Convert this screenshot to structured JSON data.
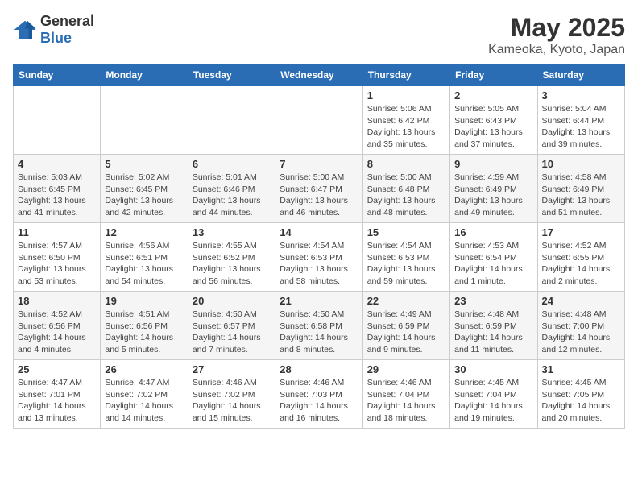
{
  "header": {
    "logo_general": "General",
    "logo_blue": "Blue",
    "title": "May 2025",
    "subtitle": "Kameoka, Kyoto, Japan"
  },
  "calendar": {
    "days_of_week": [
      "Sunday",
      "Monday",
      "Tuesday",
      "Wednesday",
      "Thursday",
      "Friday",
      "Saturday"
    ],
    "weeks": [
      [
        {
          "day": "",
          "info": ""
        },
        {
          "day": "",
          "info": ""
        },
        {
          "day": "",
          "info": ""
        },
        {
          "day": "",
          "info": ""
        },
        {
          "day": "1",
          "info": "Sunrise: 5:06 AM\nSunset: 6:42 PM\nDaylight: 13 hours\nand 35 minutes."
        },
        {
          "day": "2",
          "info": "Sunrise: 5:05 AM\nSunset: 6:43 PM\nDaylight: 13 hours\nand 37 minutes."
        },
        {
          "day": "3",
          "info": "Sunrise: 5:04 AM\nSunset: 6:44 PM\nDaylight: 13 hours\nand 39 minutes."
        }
      ],
      [
        {
          "day": "4",
          "info": "Sunrise: 5:03 AM\nSunset: 6:45 PM\nDaylight: 13 hours\nand 41 minutes."
        },
        {
          "day": "5",
          "info": "Sunrise: 5:02 AM\nSunset: 6:45 PM\nDaylight: 13 hours\nand 42 minutes."
        },
        {
          "day": "6",
          "info": "Sunrise: 5:01 AM\nSunset: 6:46 PM\nDaylight: 13 hours\nand 44 minutes."
        },
        {
          "day": "7",
          "info": "Sunrise: 5:00 AM\nSunset: 6:47 PM\nDaylight: 13 hours\nand 46 minutes."
        },
        {
          "day": "8",
          "info": "Sunrise: 5:00 AM\nSunset: 6:48 PM\nDaylight: 13 hours\nand 48 minutes."
        },
        {
          "day": "9",
          "info": "Sunrise: 4:59 AM\nSunset: 6:49 PM\nDaylight: 13 hours\nand 49 minutes."
        },
        {
          "day": "10",
          "info": "Sunrise: 4:58 AM\nSunset: 6:49 PM\nDaylight: 13 hours\nand 51 minutes."
        }
      ],
      [
        {
          "day": "11",
          "info": "Sunrise: 4:57 AM\nSunset: 6:50 PM\nDaylight: 13 hours\nand 53 minutes."
        },
        {
          "day": "12",
          "info": "Sunrise: 4:56 AM\nSunset: 6:51 PM\nDaylight: 13 hours\nand 54 minutes."
        },
        {
          "day": "13",
          "info": "Sunrise: 4:55 AM\nSunset: 6:52 PM\nDaylight: 13 hours\nand 56 minutes."
        },
        {
          "day": "14",
          "info": "Sunrise: 4:54 AM\nSunset: 6:53 PM\nDaylight: 13 hours\nand 58 minutes."
        },
        {
          "day": "15",
          "info": "Sunrise: 4:54 AM\nSunset: 6:53 PM\nDaylight: 13 hours\nand 59 minutes."
        },
        {
          "day": "16",
          "info": "Sunrise: 4:53 AM\nSunset: 6:54 PM\nDaylight: 14 hours\nand 1 minute."
        },
        {
          "day": "17",
          "info": "Sunrise: 4:52 AM\nSunset: 6:55 PM\nDaylight: 14 hours\nand 2 minutes."
        }
      ],
      [
        {
          "day": "18",
          "info": "Sunrise: 4:52 AM\nSunset: 6:56 PM\nDaylight: 14 hours\nand 4 minutes."
        },
        {
          "day": "19",
          "info": "Sunrise: 4:51 AM\nSunset: 6:56 PM\nDaylight: 14 hours\nand 5 minutes."
        },
        {
          "day": "20",
          "info": "Sunrise: 4:50 AM\nSunset: 6:57 PM\nDaylight: 14 hours\nand 7 minutes."
        },
        {
          "day": "21",
          "info": "Sunrise: 4:50 AM\nSunset: 6:58 PM\nDaylight: 14 hours\nand 8 minutes."
        },
        {
          "day": "22",
          "info": "Sunrise: 4:49 AM\nSunset: 6:59 PM\nDaylight: 14 hours\nand 9 minutes."
        },
        {
          "day": "23",
          "info": "Sunrise: 4:48 AM\nSunset: 6:59 PM\nDaylight: 14 hours\nand 11 minutes."
        },
        {
          "day": "24",
          "info": "Sunrise: 4:48 AM\nSunset: 7:00 PM\nDaylight: 14 hours\nand 12 minutes."
        }
      ],
      [
        {
          "day": "25",
          "info": "Sunrise: 4:47 AM\nSunset: 7:01 PM\nDaylight: 14 hours\nand 13 minutes."
        },
        {
          "day": "26",
          "info": "Sunrise: 4:47 AM\nSunset: 7:02 PM\nDaylight: 14 hours\nand 14 minutes."
        },
        {
          "day": "27",
          "info": "Sunrise: 4:46 AM\nSunset: 7:02 PM\nDaylight: 14 hours\nand 15 minutes."
        },
        {
          "day": "28",
          "info": "Sunrise: 4:46 AM\nSunset: 7:03 PM\nDaylight: 14 hours\nand 16 minutes."
        },
        {
          "day": "29",
          "info": "Sunrise: 4:46 AM\nSunset: 7:04 PM\nDaylight: 14 hours\nand 18 minutes."
        },
        {
          "day": "30",
          "info": "Sunrise: 4:45 AM\nSunset: 7:04 PM\nDaylight: 14 hours\nand 19 minutes."
        },
        {
          "day": "31",
          "info": "Sunrise: 4:45 AM\nSunset: 7:05 PM\nDaylight: 14 hours\nand 20 minutes."
        }
      ]
    ]
  }
}
